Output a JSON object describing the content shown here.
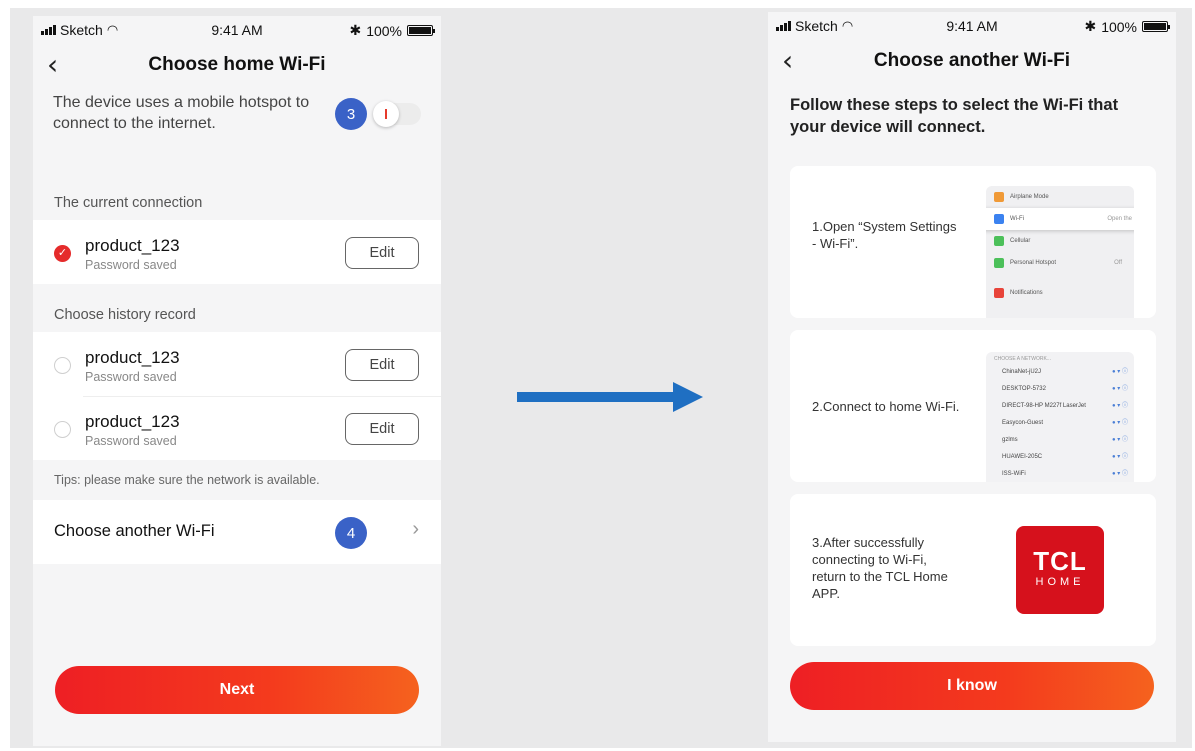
{
  "left_screen": {
    "status": {
      "carrier": "Sketch",
      "time": "9:41 AM",
      "battery": "100%"
    },
    "title": "Choose home Wi-Fi",
    "hotspot_text": "The device uses a mobile hotspot to connect to the internet.",
    "hotspot_badge": "3",
    "hotspot_toggle_on": false,
    "current_label": "The current connection",
    "current_item": {
      "name": "product_123",
      "status": "Password saved",
      "edit": "Edit",
      "selected": true
    },
    "history_label": "Choose history record",
    "history_items": [
      {
        "name": "product_123",
        "status": "Password saved",
        "edit": "Edit"
      },
      {
        "name": "product_123",
        "status": "Password saved",
        "edit": "Edit"
      }
    ],
    "tips": "Tips: please make sure the network is available.",
    "another_label": "Choose another Wi-Fi",
    "another_badge": "4",
    "next_label": "Next"
  },
  "right_screen": {
    "status": {
      "carrier": "Sketch",
      "time": "9:41 AM",
      "battery": "100%"
    },
    "title": "Choose another Wi-Fi",
    "intro": "Follow these steps to select the Wi-Fi that your device  will connect.",
    "steps": [
      {
        "text": "1.Open “System Settings - Wi-Fi”."
      },
      {
        "text": "2.Connect to home Wi-Fi."
      },
      {
        "text": "3.After successfully connecting to Wi-Fi, return to the TCL Home APP."
      }
    ],
    "settings_rows": [
      {
        "label": "Airplane Mode",
        "value": "",
        "color": "#f09a37"
      },
      {
        "label": "Wi-Fi",
        "value": "Open the",
        "color": "#3b82f0"
      },
      {
        "label": "Cellular",
        "value": "",
        "color": "#4cc05a"
      },
      {
        "label": "Personal Hotspot",
        "value": "Off",
        "color": "#4cc05a"
      },
      {
        "label": "Notifications",
        "value": "",
        "color": "#e8443a"
      }
    ],
    "networks_header": "CHOOSE A NETWORK...",
    "networks": [
      "ChinaNet-jU2J",
      "DESKTOP-5732",
      "DIRECT-98-HP M227f LaserJet",
      "Easycon-Guest",
      "gzlms",
      "HUAWEI-205C",
      "ISS-WiFi"
    ],
    "logo": {
      "line1": "TCL",
      "line2": "HOME"
    },
    "iknow_label": "I know"
  },
  "colors": {
    "accent_red": "#ee1f24",
    "accent_orange": "#f5621e",
    "badge_blue": "#3a62c7",
    "arrow_blue": "#1f6fc2",
    "tcl_red": "#d6111c"
  }
}
